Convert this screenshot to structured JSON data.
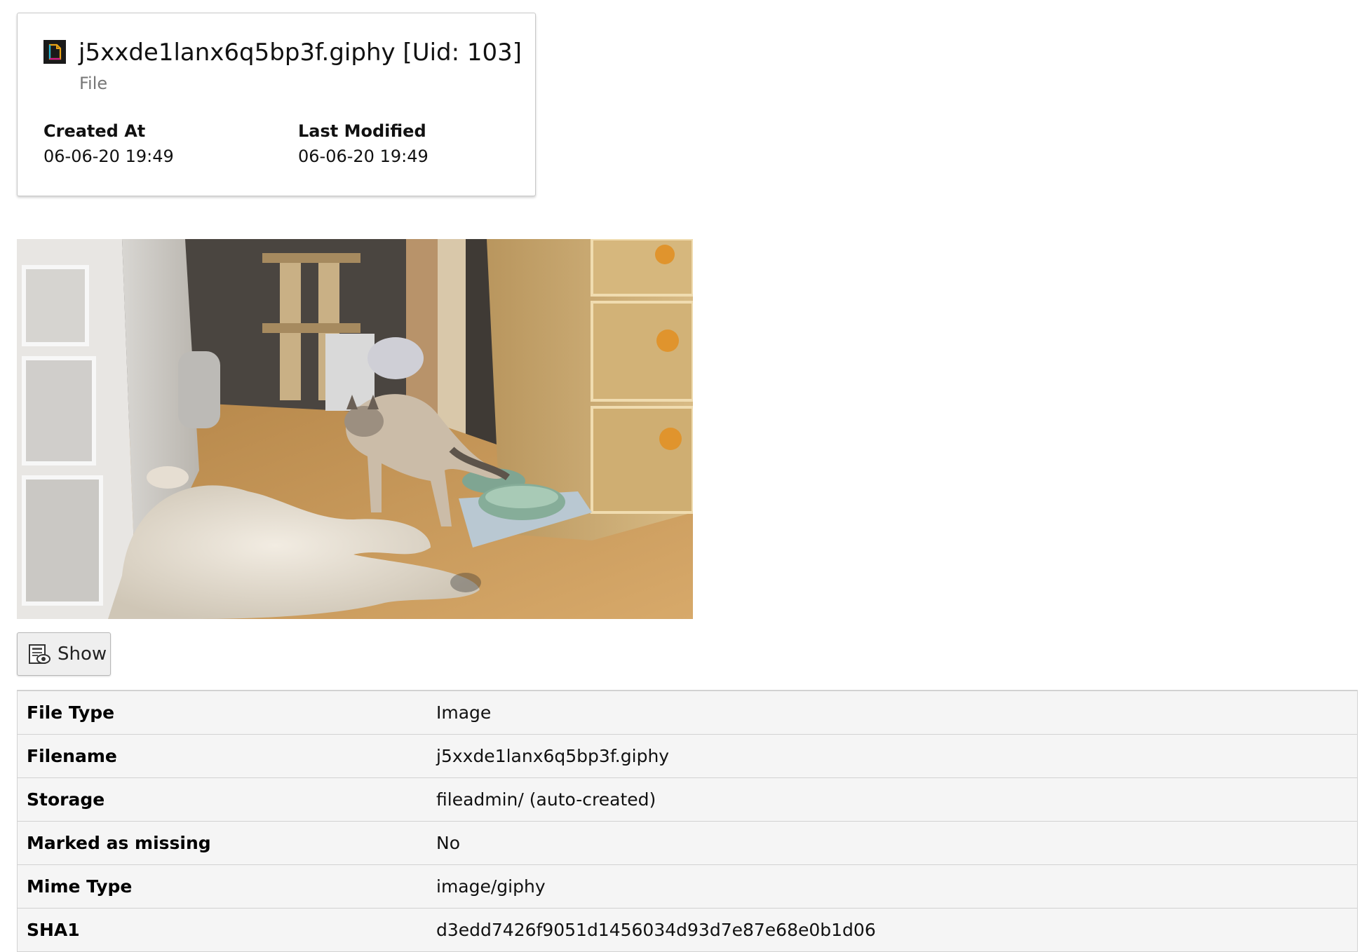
{
  "header": {
    "title": "j5xxde1lanx6q5bp3f.giphy [Uid: 103]",
    "subtitle": "File",
    "icon": "file-icon",
    "created_label": "Created At",
    "created_value": "06-06-20 19:49",
    "modified_label": "Last Modified",
    "modified_value": "06-06-20 19:49"
  },
  "preview": {
    "icon": "image-preview"
  },
  "show_button": {
    "label": "Show",
    "icon": "preview-eye-icon"
  },
  "properties": [
    {
      "label": "File Type",
      "value": "Image"
    },
    {
      "label": "Filename",
      "value": "j5xxde1lanx6q5bp3f.giphy"
    },
    {
      "label": "Storage",
      "value": "fileadmin/ (auto-created)"
    },
    {
      "label": "Marked as missing",
      "value": "No"
    },
    {
      "label": "Mime Type",
      "value": "image/giphy"
    },
    {
      "label": "SHA1",
      "value": "d3edd7426f9051d1456034d93d7e87e68e0b1d06"
    }
  ],
  "colors": {
    "icon_orange": "#e8a317",
    "icon_cyan": "#21b8d8",
    "icon_magenta": "#d81b8b"
  }
}
